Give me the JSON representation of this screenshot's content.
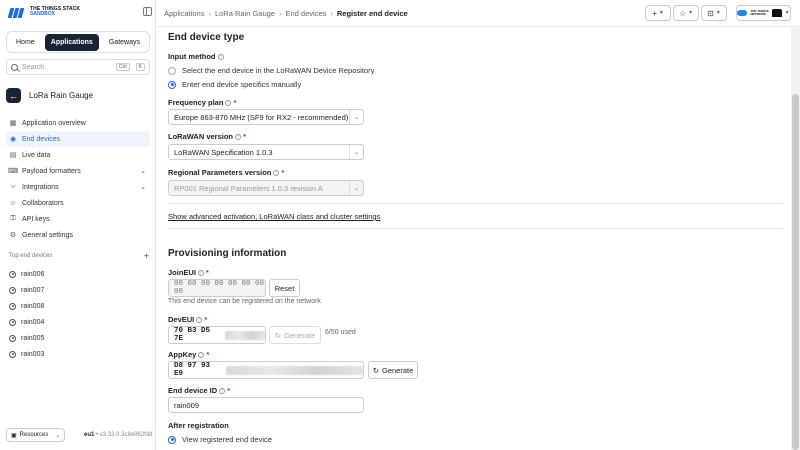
{
  "brand": {
    "line1": "THE THINGS STACK",
    "line2": "SANDBOX"
  },
  "switcher": {
    "tabs": [
      "Home",
      "Applications",
      "Gateways"
    ],
    "active": "Applications"
  },
  "search": {
    "placeholder": "Search",
    "kbd1": "Ctrl",
    "kbd2": "K"
  },
  "app": {
    "name": "LoRa Rain Gauge"
  },
  "nav": {
    "overview": "Application overview",
    "end_devices": "End devices",
    "live_data": "Live data",
    "payload_formatters": "Payload formatters",
    "integrations": "Integrations",
    "collaborators": "Collaborators",
    "api_keys": "API keys",
    "general_settings": "General settings"
  },
  "top_devices": {
    "heading": "Top end devices",
    "add": "+",
    "items": [
      "rain006",
      "rain007",
      "rain008",
      "rain004",
      "rain005",
      "rain003"
    ]
  },
  "footer": {
    "resources": "Resources",
    "cluster": "eu1",
    "version": "v3.33.0.3c8e962fdd"
  },
  "breadcrumb": {
    "c1": "Applications",
    "c2": "LoRa Rain Gauge",
    "c3": "End devices",
    "c4": "Register end device"
  },
  "toolbar": {
    "plus": "+",
    "star": "☆",
    "inbox": "⊡",
    "ttn1": "THE THINGS",
    "ttn2": "NETWORK"
  },
  "form": {
    "section1_title": "End device type",
    "input_method_label": "Input method",
    "radio1": "Select the end device in the LoRaWAN Device Repository",
    "radio2": "Enter end device specifics manually",
    "freq_label": "Frequency plan",
    "freq_value": "Europe 863-870 MHz (SF9 for RX2 - recommended)",
    "lorawan_label": "LoRaWAN version",
    "lorawan_value": "LoRaWAN Specification 1.0.3",
    "regional_label": "Regional Parameters version",
    "regional_value": "RP001 Regional Parameters 1.0.3 revision A",
    "advanced_link": "Show advanced activation, LoRaWAN class and cluster settings",
    "section2_title": "Provisioning information",
    "joineui_label": "JoinEUI",
    "joineui_value": "00 00 00 00 00 00 00 00",
    "reset_btn": "Reset",
    "joineui_note": "This end device can be registered on the network",
    "deveui_label": "DevEUI",
    "deveui_value": "70 B3 D5 7E",
    "generate_btn": "Generate",
    "deveui_count": "6/50 used",
    "appkey_label": "AppKey",
    "appkey_value": "D8 97 93 E9",
    "appkey_generate_btn": "Generate",
    "device_id_label": "End device ID",
    "device_id_value": "rain009",
    "after_reg_label": "After registration",
    "after_reg_option": "View registered end device"
  }
}
